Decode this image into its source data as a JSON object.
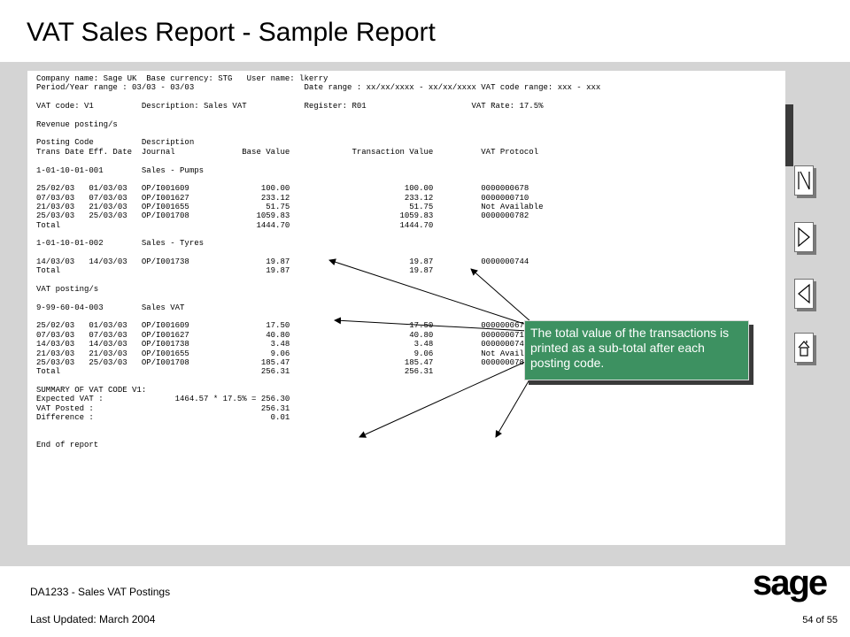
{
  "title": "VAT Sales Report - Sample Report",
  "report_lines": [
    "Company name: Sage UK  Base currency: STG   User name: lkerry",
    "Period/Year range : 03/03 - 03/03                       Date range : xx/xx/xxxx - xx/xx/xxxx VAT code range: xxx - xxx",
    "",
    "VAT code: V1          Description: Sales VAT            Register: R01                      VAT Rate: 17.5%",
    "",
    "Revenue posting/s",
    "",
    "Posting Code          Description",
    "Trans Date Eff. Date  Journal              Base Value             Transaction Value          VAT Protocol",
    "",
    "1-01-10-01-001        Sales - Pumps",
    "",
    "25/02/03   01/03/03   OP/I001609               100.00                        100.00          0000000678",
    "07/03/03   07/03/03   OP/I001627               233.12                        233.12          0000000710",
    "21/03/03   21/03/03   OP/I001655                51.75                         51.75          Not Available",
    "25/03/03   25/03/03   OP/I001708              1059.83                       1059.83          0000000782",
    "Total                                         1444.70                       1444.70",
    "",
    "1-01-10-01-002        Sales - Tyres",
    "",
    "14/03/03   14/03/03   OP/I001738                19.87                         19.87          0000000744",
    "Total                                           19.87                         19.87",
    "",
    "VAT posting/s",
    "",
    "9-99-60-04-003        Sales VAT",
    "",
    "25/02/03   01/03/03   OP/I001609                17.50                         17.50          0000000678",
    "07/03/03   07/03/03   OP/I001627                40.80                         40.80          0000000710",
    "14/03/03   14/03/03   OP/I001738                 3.48                          3.48          0000000744",
    "21/03/03   21/03/03   OP/I001655                 9.06                          9.06          Not Available",
    "25/03/03   25/03/03   OP/I001708               185.47                        185.47          0000000782",
    "Total                                          256.31                        256.31",
    "",
    "SUMMARY OF VAT CODE V1:",
    "Expected VAT :               1464.57 * 17.5% = 256.30",
    "VAT Posted :                                   256.31",
    "Difference :                                     0.01",
    "",
    "",
    "End of report"
  ],
  "callout_text": "The total value of the transactions is printed as a sub-total after each posting code.",
  "footer": {
    "course": "DA1233 - Sales VAT Postings",
    "updated": "Last Updated:  March 2004",
    "page": "54 of 55",
    "logo_text": "sage"
  },
  "nav": {
    "first_icon": "first-page-icon",
    "next_icon": "next-page-icon",
    "prev_icon": "previous-page-icon",
    "home_icon": "home-icon"
  },
  "colors": {
    "callout": "#3d9161",
    "band": "#d4d4d4"
  }
}
